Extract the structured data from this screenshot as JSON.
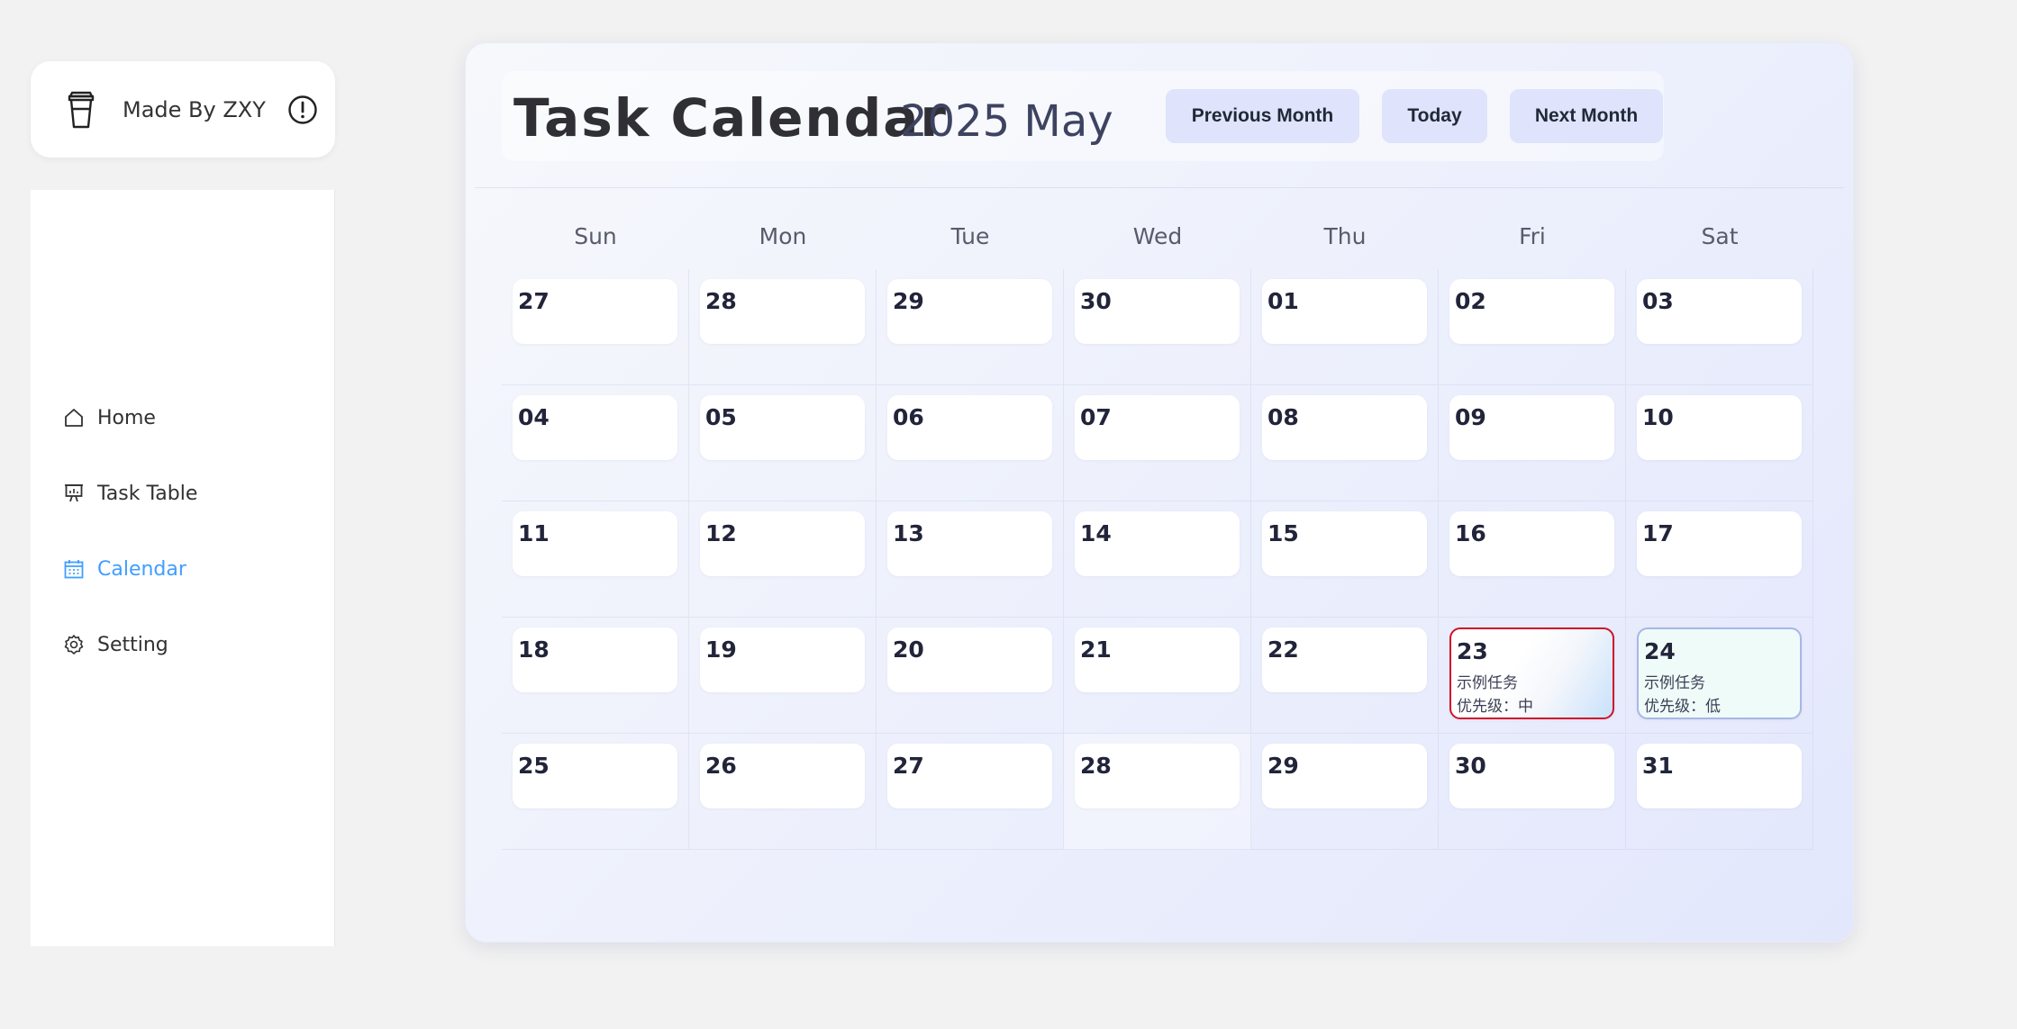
{
  "brand": {
    "text": "Made By ZXY"
  },
  "sidebar": {
    "items": [
      {
        "label": "Home"
      },
      {
        "label": "Task Table"
      },
      {
        "label": "Calendar"
      },
      {
        "label": "Setting"
      }
    ],
    "active_color": "#409eff"
  },
  "calendar": {
    "title": "Task Calendar",
    "month_label": "2025 May",
    "buttons": {
      "prev": "Previous Month",
      "today": "Today",
      "next": "Next Month"
    },
    "weekdays": [
      "Sun",
      "Mon",
      "Tue",
      "Wed",
      "Thu",
      "Fri",
      "Sat"
    ],
    "weeks": [
      [
        {
          "day": "27"
        },
        {
          "day": "28"
        },
        {
          "day": "29"
        },
        {
          "day": "30"
        },
        {
          "day": "01"
        },
        {
          "day": "02"
        },
        {
          "day": "03"
        }
      ],
      [
        {
          "day": "04"
        },
        {
          "day": "05"
        },
        {
          "day": "06"
        },
        {
          "day": "07"
        },
        {
          "day": "08"
        },
        {
          "day": "09"
        },
        {
          "day": "10"
        }
      ],
      [
        {
          "day": "11"
        },
        {
          "day": "12"
        },
        {
          "day": "13"
        },
        {
          "day": "14"
        },
        {
          "day": "15"
        },
        {
          "day": "16"
        },
        {
          "day": "17"
        }
      ],
      [
        {
          "day": "18"
        },
        {
          "day": "19"
        },
        {
          "day": "20"
        },
        {
          "day": "21"
        },
        {
          "day": "22"
        },
        {
          "day": "23",
          "task": "示例任务",
          "priority": "优先级：中",
          "level": "mid"
        },
        {
          "day": "24",
          "task": "示例任务",
          "priority": "优先级：低",
          "level": "low"
        }
      ],
      [
        {
          "day": "25"
        },
        {
          "day": "26"
        },
        {
          "day": "27"
        },
        {
          "day": "28",
          "highlight": true
        },
        {
          "day": "29"
        },
        {
          "day": "30"
        },
        {
          "day": "31"
        }
      ]
    ],
    "colors": {
      "priority_mid_border": "#d0112b",
      "priority_low_border": "#a8b6e6",
      "button_bg": "#dfe3fb"
    }
  }
}
